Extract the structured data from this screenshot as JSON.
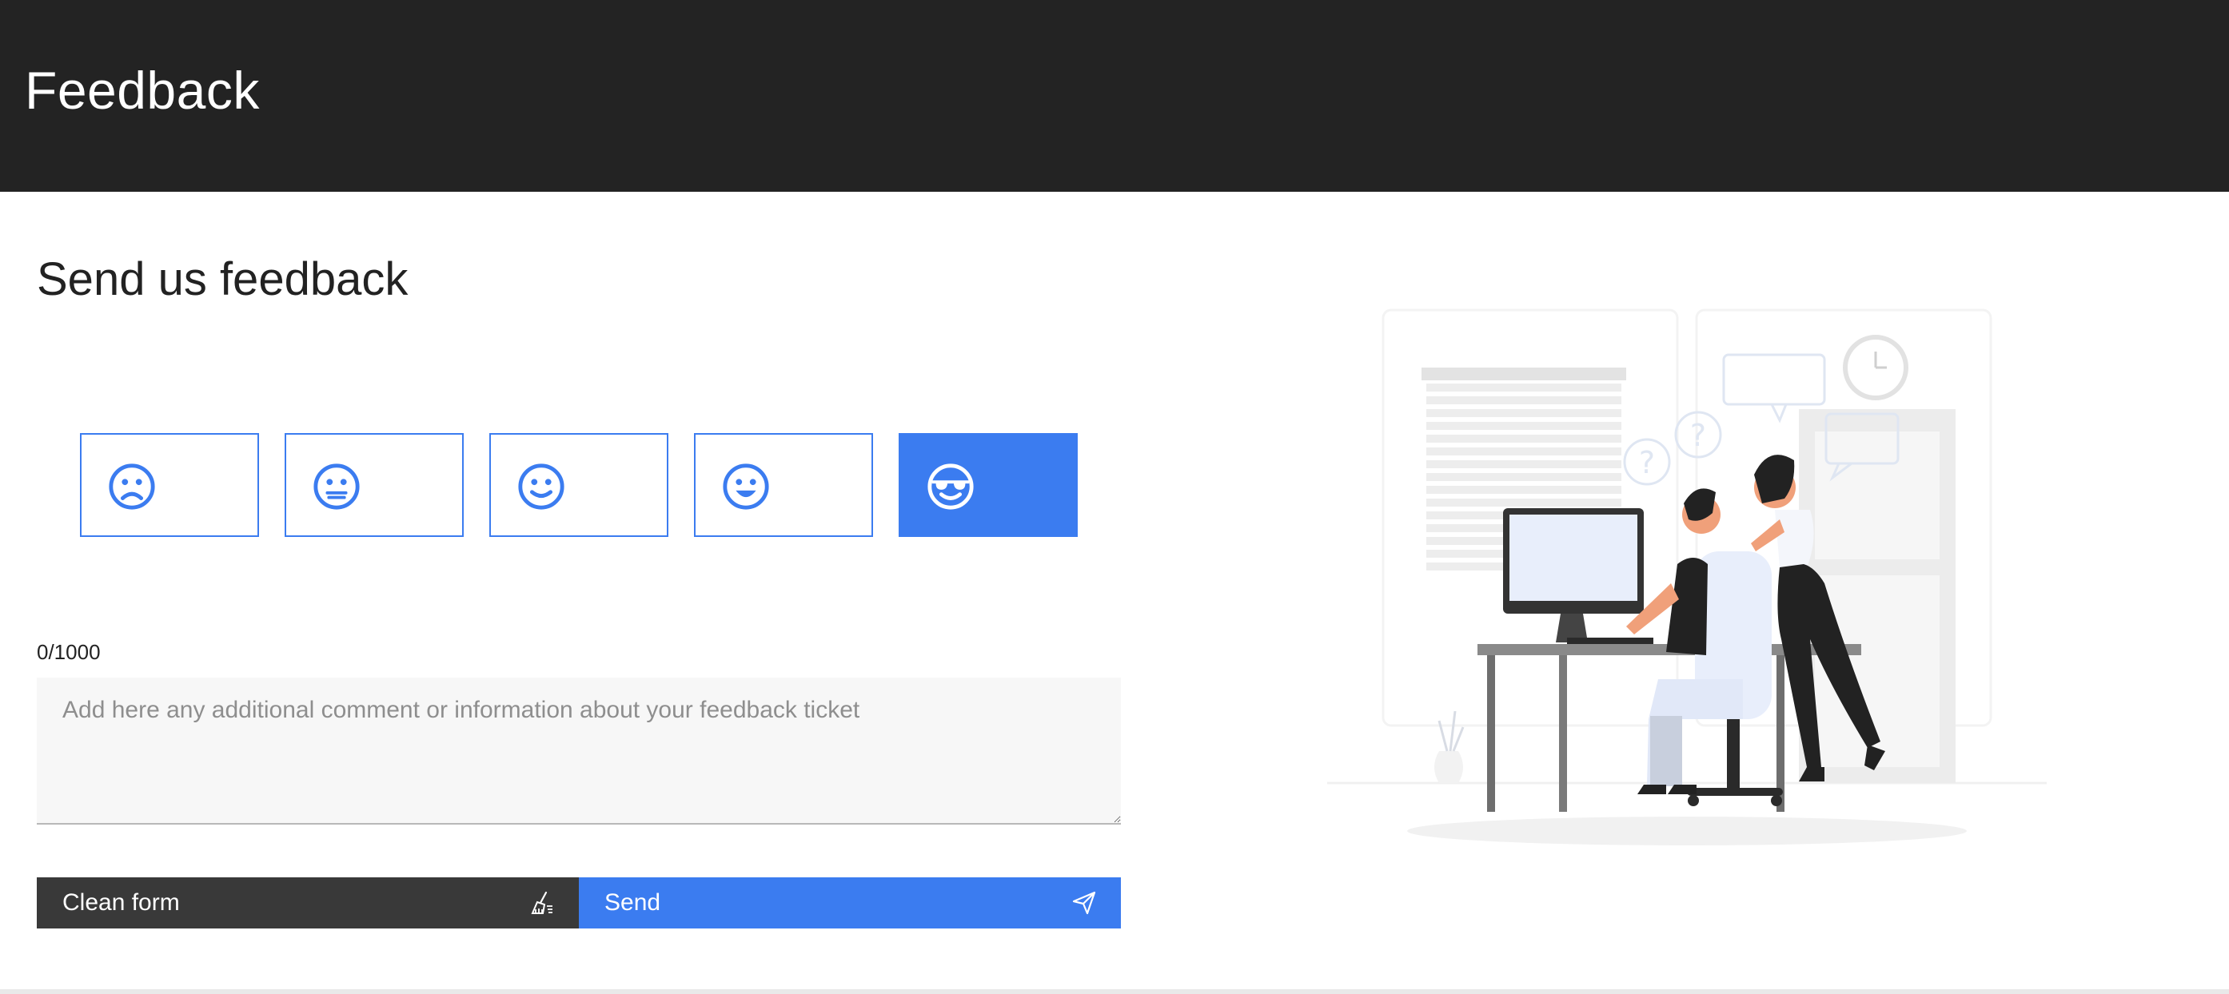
{
  "header": {
    "title": "Feedback"
  },
  "page": {
    "title": "Send us feedback"
  },
  "rating": {
    "options": [
      {
        "icon": "sad-face-icon",
        "selected": false
      },
      {
        "icon": "neutral-face-icon",
        "selected": false
      },
      {
        "icon": "slight-smile-face-icon",
        "selected": false
      },
      {
        "icon": "happy-face-icon",
        "selected": false
      },
      {
        "icon": "sunglasses-face-icon",
        "selected": true
      }
    ]
  },
  "comment": {
    "counter": "0/1000",
    "value": "",
    "placeholder": "Add here any additional comment or information about your feedback ticket"
  },
  "actions": {
    "clean_label": "Clean form",
    "clean_icon": "broom-icon",
    "send_label": "Send",
    "send_icon": "paper-plane-icon"
  },
  "colors": {
    "header_bg": "#232323",
    "accent": "#3b7cf0",
    "secondary_button": "#393939",
    "input_bg": "#f7f7f7"
  }
}
